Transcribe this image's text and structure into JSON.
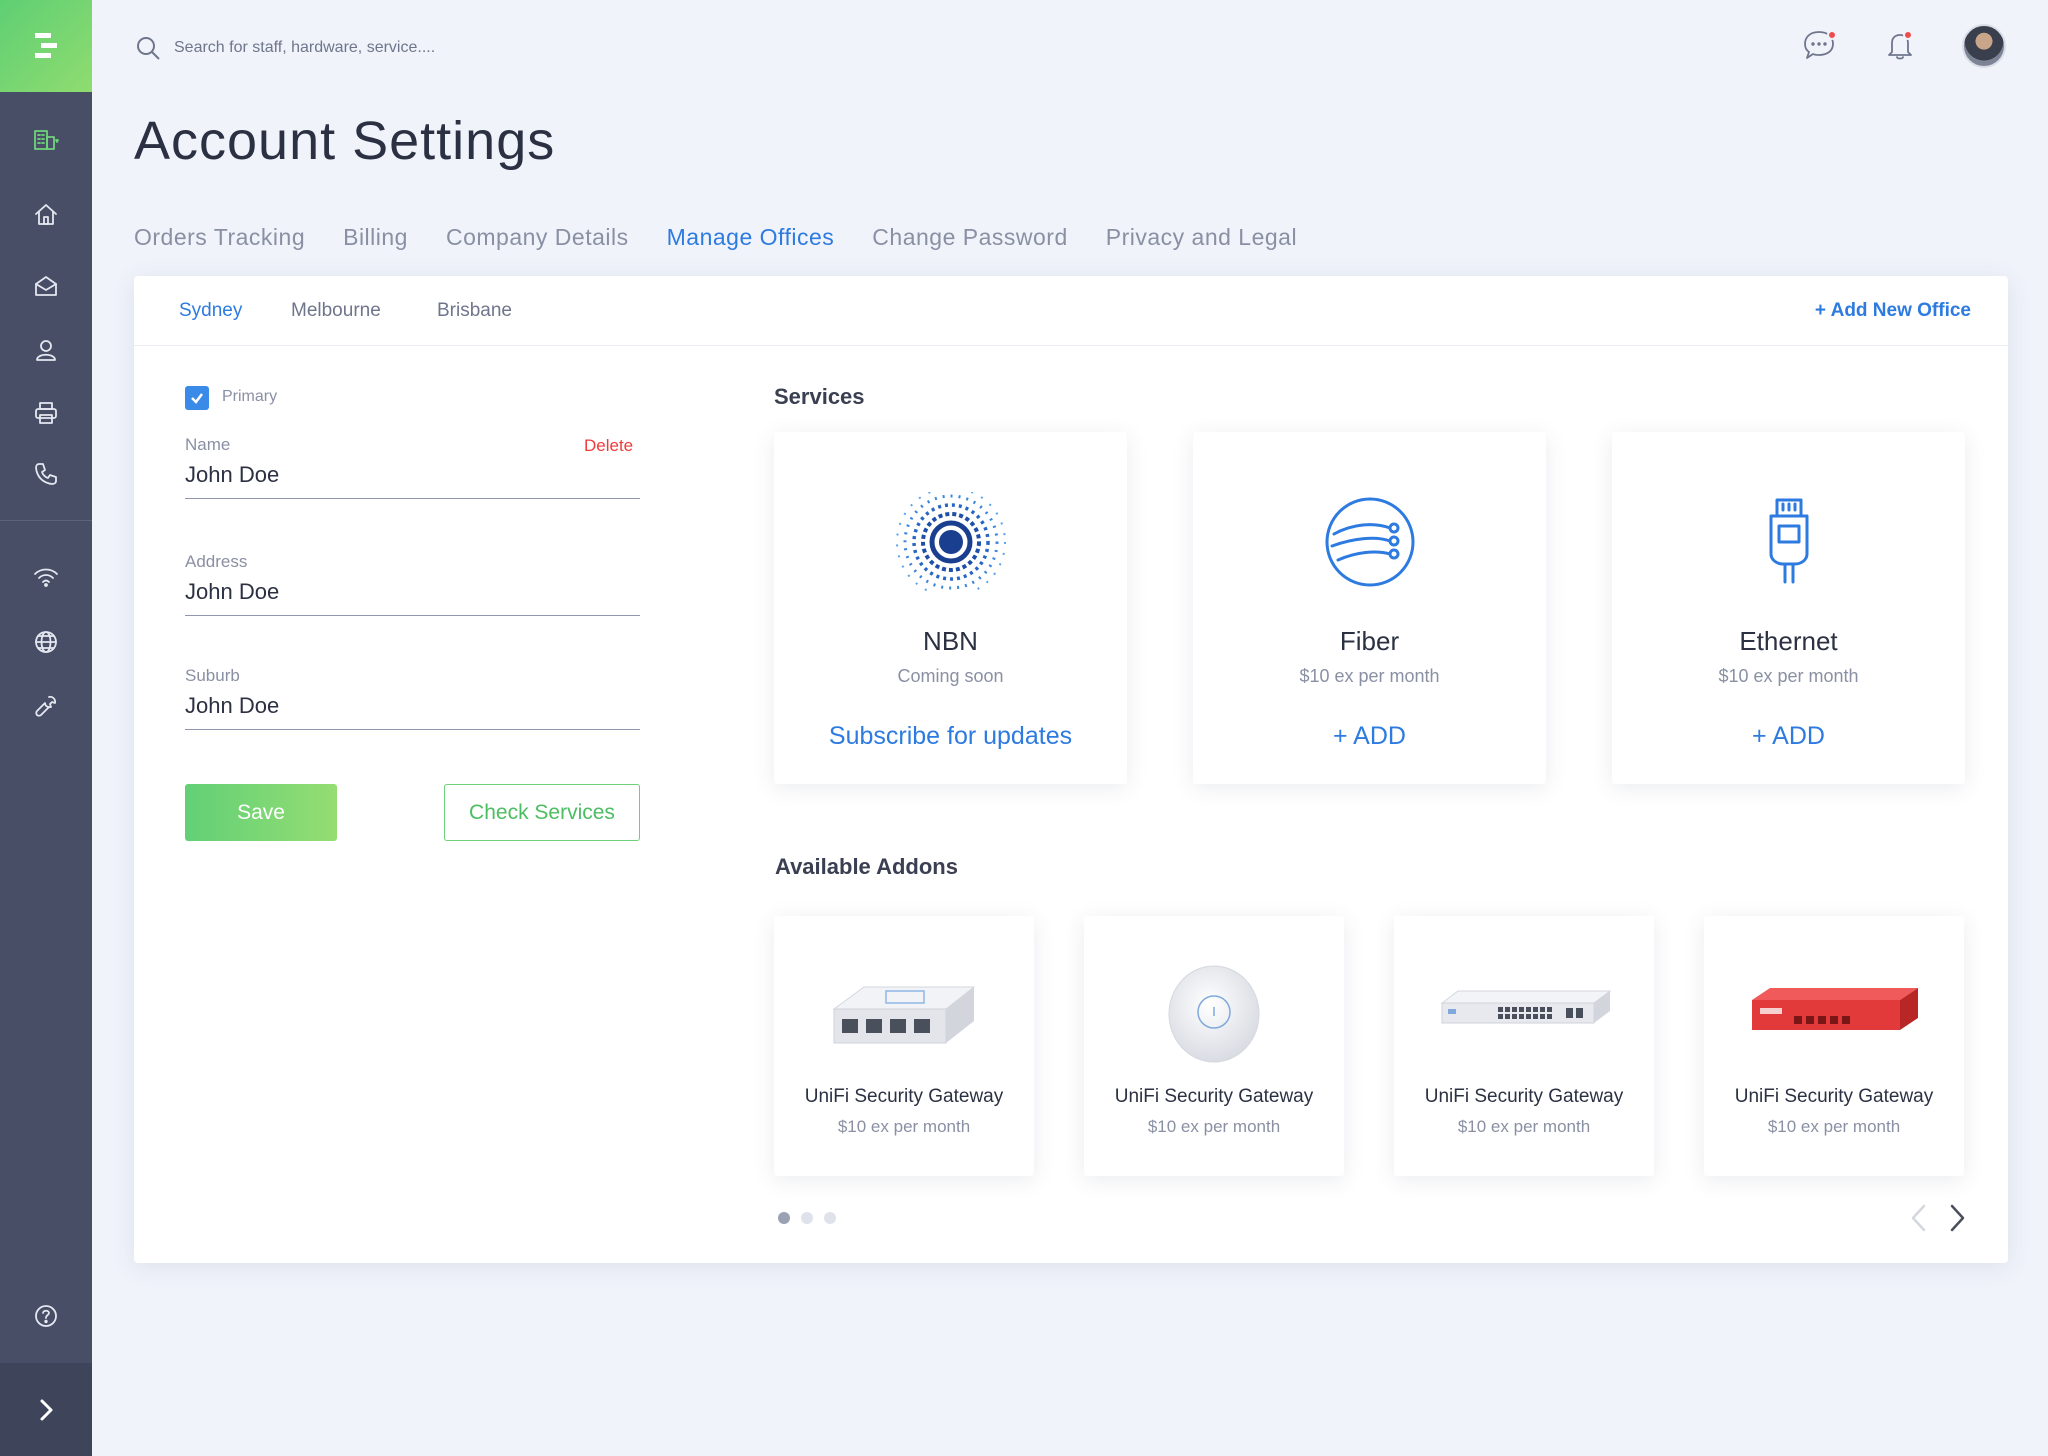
{
  "search": {
    "placeholder": "Search for staff, hardware, service...."
  },
  "page": {
    "title": "Account Settings"
  },
  "tabs": [
    {
      "label": "Orders Tracking"
    },
    {
      "label": "Billing"
    },
    {
      "label": "Company Details"
    },
    {
      "label": "Manage Offices"
    },
    {
      "label": "Change Password"
    },
    {
      "label": "Privacy and Legal"
    }
  ],
  "active_tab": "Manage Offices",
  "offices": [
    {
      "label": "Sydney"
    },
    {
      "label": "Melbourne"
    },
    {
      "label": "Brisbane"
    }
  ],
  "active_office": "Sydney",
  "add_office_label": "+ Add New Office",
  "form": {
    "primary_label": "Primary",
    "primary_checked": true,
    "name_label": "Name",
    "name_value": "John Doe",
    "delete_label": "Delete",
    "address_label": "Address",
    "address_value": "John Doe",
    "suburb_label": "Suburb",
    "suburb_value": "John Doe",
    "save_label": "Save",
    "check_label": "Check Services"
  },
  "services": {
    "title": "Services",
    "items": [
      {
        "name": "NBN",
        "sub": "Coming soon",
        "action": "Subscribe for updates",
        "icon": "nbn-logo-icon"
      },
      {
        "name": "Fiber",
        "sub": "$10 ex per month",
        "action": "+ ADD",
        "icon": "fiber-globe-icon"
      },
      {
        "name": "Ethernet",
        "sub": "$10 ex per month",
        "action": "+ ADD",
        "icon": "ethernet-plug-icon"
      }
    ]
  },
  "addons": {
    "title": "Available Addons",
    "items": [
      {
        "name": "UniFi Security Gateway",
        "price": "$10 ex per month",
        "image": "security-gateway-image"
      },
      {
        "name": "UniFi Security Gateway",
        "price": "$10 ex per month",
        "image": "access-point-image"
      },
      {
        "name": "UniFi Security Gateway",
        "price": "$10 ex per month",
        "image": "network-switch-image"
      },
      {
        "name": "UniFi Security Gateway",
        "price": "$10 ex per month",
        "image": "firewall-appliance-image"
      }
    ],
    "pages": 3,
    "current_page": 1
  },
  "colors": {
    "accent": "#2d7be0",
    "success": "#62d077",
    "danger": "#ef3b3b",
    "sidebar": "#474e66"
  }
}
